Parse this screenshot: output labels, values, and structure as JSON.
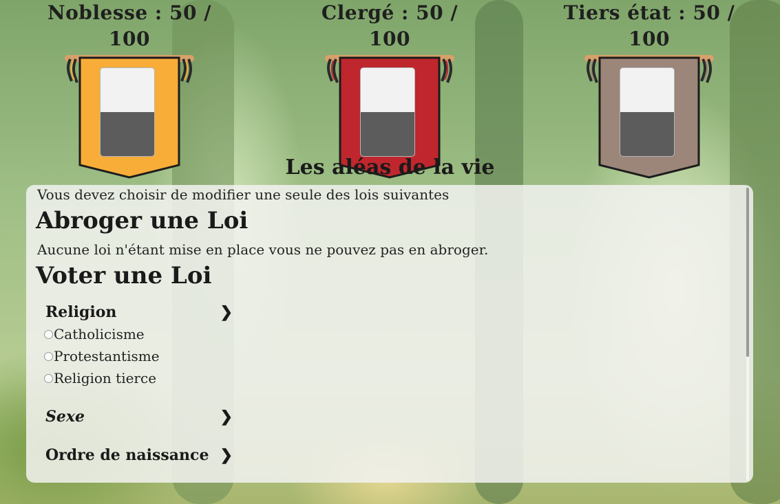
{
  "estates": [
    {
      "name": "Noblesse : 50 / 100",
      "value": 50,
      "max": 100,
      "color": "#f7ad38",
      "tassel": "#2a2a2a",
      "tassel2": "#f7ad38"
    },
    {
      "name": "Clergé : 50 / 100",
      "value": 50,
      "max": 100,
      "color": "#c0262d",
      "tassel": "#2a2a2a",
      "tassel2": "#c0262d"
    },
    {
      "name": "Tiers état : 50 / 100",
      "value": 50,
      "max": 100,
      "color": "#9b8679",
      "tassel": "#2a2a2a",
      "tassel2": "#9b8679"
    }
  ],
  "section_title": "Les aléas de la vie",
  "panel": {
    "intro": "Vous devez choisir de modifier une seule des lois suivantes",
    "abroger_title": "Abroger une Loi",
    "abroger_text": "Aucune loi n'étant mise en place vous ne pouvez pas en abroger.",
    "voter_title": "Voter une Loi",
    "laws": [
      {
        "label": "Religion",
        "chevron": "❯",
        "options": [
          "Catholicisme",
          "Protestantisme",
          "Religion tierce"
        ]
      },
      {
        "label": "Sexe",
        "chevron": "❯"
      },
      {
        "label": "Ordre de naissance",
        "chevron": "❯"
      }
    ]
  }
}
